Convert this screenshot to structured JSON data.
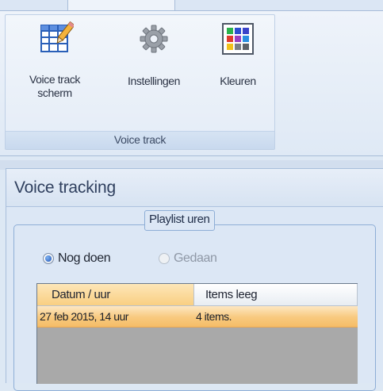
{
  "ribbon": {
    "group_label": "Voice track",
    "buttons": {
      "voicetrack_line1": "Voice track",
      "voicetrack_line2": "scherm",
      "instellingen": "Instellingen",
      "kleuren": "Kleuren"
    }
  },
  "panel": {
    "title": "Voice tracking",
    "groupbox_title": "Playlist uren",
    "radios": {
      "nog_doen": "Nog doen",
      "gedaan": "Gedaan"
    },
    "grid": {
      "columns": [
        "Datum / uur",
        "Items leeg"
      ],
      "rows": [
        [
          "27 feb 2015, 14 uur",
          "4 items."
        ]
      ]
    }
  },
  "colors": {
    "accent_orange": "#f8c97e",
    "ribbon_blue": "#dfe9f5"
  }
}
